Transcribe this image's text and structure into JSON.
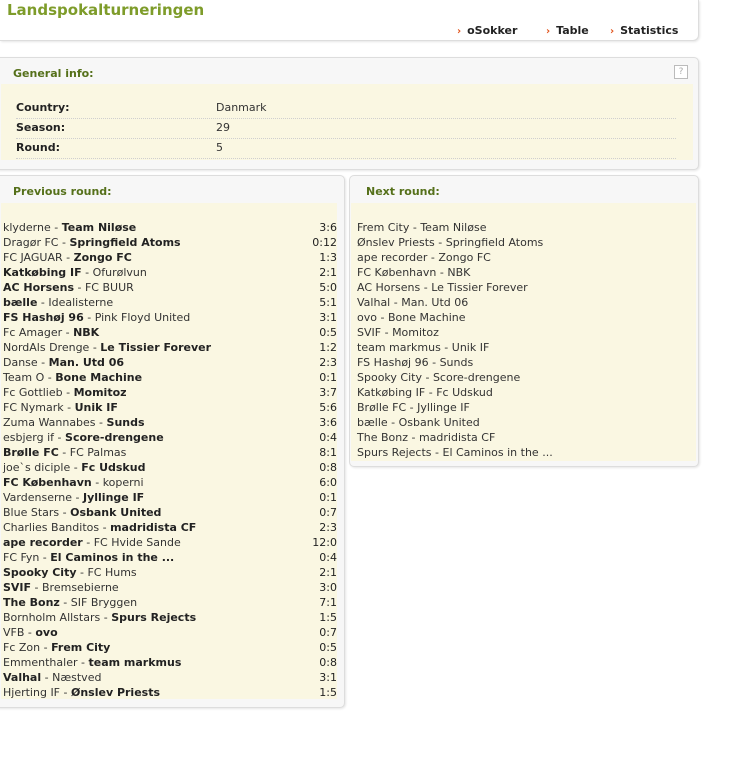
{
  "site": {
    "title": "Landspokalturneringen"
  },
  "nav": {
    "items": [
      {
        "label": "oSokker"
      },
      {
        "label": "Table"
      },
      {
        "label": "Statistics"
      }
    ]
  },
  "general": {
    "heading": "General info:",
    "help_icon": "?",
    "rows": [
      {
        "label": "Country:",
        "value": "Danmark"
      },
      {
        "label": "Season:",
        "value": "29"
      },
      {
        "label": "Round:",
        "value": "5"
      }
    ]
  },
  "previous": {
    "heading": "Previous round:",
    "matches": [
      {
        "home": "klyderne",
        "away": "Team Niløse",
        "score": "3:6",
        "winner": "away"
      },
      {
        "home": "Dragør FC",
        "away": "Springfield Atoms",
        "score": "0:12",
        "winner": "away"
      },
      {
        "home": "FC JAGUAR",
        "away": "Zongo FC",
        "score": "1:3",
        "winner": "away"
      },
      {
        "home": "Katkøbing IF",
        "away": "Ofurølvun",
        "score": "2:1",
        "winner": "home"
      },
      {
        "home": "AC Horsens",
        "away": "FC BUUR",
        "score": "5:0",
        "winner": "home"
      },
      {
        "home": "bælle",
        "away": "Idealisterne",
        "score": "5:1",
        "winner": "home"
      },
      {
        "home": "FS Hashøj 96",
        "away": "Pink Floyd United",
        "score": "3:1",
        "winner": "home"
      },
      {
        "home": "Fc Amager",
        "away": "NBK",
        "score": "0:5",
        "winner": "away"
      },
      {
        "home": "NordAls Drenge",
        "away": "Le Tissier Forever",
        "score": "1:2",
        "winner": "away"
      },
      {
        "home": "Danse",
        "away": "Man. Utd 06",
        "score": "2:3",
        "winner": "away"
      },
      {
        "home": "Team O",
        "away": "Bone Machine",
        "score": "0:1",
        "winner": "away"
      },
      {
        "home": "Fc Gottlieb",
        "away": "Momitoz",
        "score": "3:7",
        "winner": "away"
      },
      {
        "home": "FC Nymark",
        "away": "Unik IF",
        "score": "5:6",
        "winner": "away"
      },
      {
        "home": "Zuma Wannabes",
        "away": "Sunds",
        "score": "3:6",
        "winner": "away"
      },
      {
        "home": "esbjerg if",
        "away": "Score-drengene",
        "score": "0:4",
        "winner": "away"
      },
      {
        "home": "Brølle FC",
        "away": "FC Palmas",
        "score": "8:1",
        "winner": "home"
      },
      {
        "home": "joe`s diciple",
        "away": "Fc Udskud",
        "score": "0:8",
        "winner": "away"
      },
      {
        "home": "FC København",
        "away": "koperni",
        "score": "6:0",
        "winner": "home"
      },
      {
        "home": "Vardenserne",
        "away": "Jyllinge IF",
        "score": "0:1",
        "winner": "away"
      },
      {
        "home": "Blue Stars",
        "away": "Osbank United",
        "score": "0:7",
        "winner": "away"
      },
      {
        "home": "Charlies Banditos",
        "away": "madridista CF",
        "score": "2:3",
        "winner": "away"
      },
      {
        "home": "ape recorder",
        "away": "FC Hvide Sande",
        "score": "12:0",
        "winner": "home"
      },
      {
        "home": "FC Fyn",
        "away": "El Caminos in the ...",
        "score": "0:4",
        "winner": "away"
      },
      {
        "home": "Spooky City",
        "away": "FC Hums",
        "score": "2:1",
        "winner": "home"
      },
      {
        "home": "SVIF",
        "away": "Bremsebierne",
        "score": "3:0",
        "winner": "home"
      },
      {
        "home": "The Bonz",
        "away": "SIF Bryggen",
        "score": "7:1",
        "winner": "home"
      },
      {
        "home": "Bornholm Allstars",
        "away": "Spurs Rejects",
        "score": "1:5",
        "winner": "away"
      },
      {
        "home": "VFB",
        "away": "ovo",
        "score": "0:7",
        "winner": "away"
      },
      {
        "home": "Fc Zon",
        "away": "Frem City",
        "score": "0:5",
        "winner": "away"
      },
      {
        "home": "Emmenthaler",
        "away": "team markmus",
        "score": "0:8",
        "winner": "away"
      },
      {
        "home": "Valhal",
        "away": "Næstved",
        "score": "3:1",
        "winner": "home"
      },
      {
        "home": "Hjerting IF",
        "away": "Ønslev Priests",
        "score": "1:5",
        "winner": "away"
      }
    ]
  },
  "next": {
    "heading": "Next round:",
    "matches": [
      {
        "home": "Frem City",
        "away": "Team Niløse"
      },
      {
        "home": "Ønslev Priests",
        "away": "Springfield Atoms"
      },
      {
        "home": "ape recorder",
        "away": "Zongo FC"
      },
      {
        "home": "FC København",
        "away": "NBK"
      },
      {
        "home": "AC Horsens",
        "away": "Le Tissier Forever"
      },
      {
        "home": "Valhal",
        "away": "Man. Utd 06"
      },
      {
        "home": "ovo",
        "away": "Bone Machine"
      },
      {
        "home": "SVIF",
        "away": "Momitoz"
      },
      {
        "home": "team markmus",
        "away": "Unik IF"
      },
      {
        "home": "FS Hashøj 96",
        "away": "Sunds"
      },
      {
        "home": "Spooky City",
        "away": "Score-drengene"
      },
      {
        "home": "Katkøbing IF",
        "away": "Fc Udskud"
      },
      {
        "home": "Brølle FC",
        "away": "Jyllinge IF"
      },
      {
        "home": "bælle",
        "away": "Osbank United"
      },
      {
        "home": "The Bonz",
        "away": "madridista CF"
      },
      {
        "home": "Spurs Rejects",
        "away": "El Caminos in the ..."
      }
    ]
  }
}
